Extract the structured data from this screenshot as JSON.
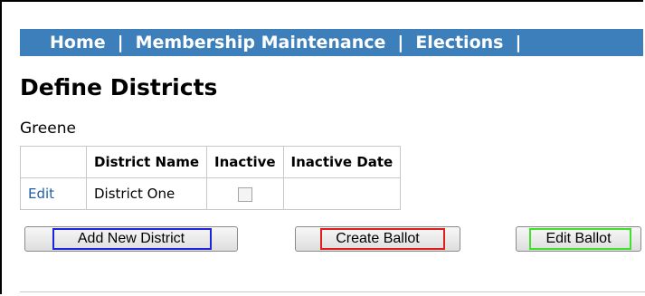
{
  "nav": {
    "items": [
      "Home",
      "Membership Maintenance",
      "Elections"
    ],
    "separator": "|"
  },
  "page": {
    "title": "Define Districts",
    "org_name": "Greene"
  },
  "table": {
    "headers": [
      "",
      "District Name",
      "Inactive",
      "Inactive Date"
    ],
    "rows": [
      {
        "action": "Edit",
        "district_name": "District One",
        "inactive": false,
        "inactive_date": ""
      }
    ]
  },
  "buttons": {
    "add_new_district": "Add New District",
    "create_ballot": "Create Ballot",
    "edit_ballot": "Edit Ballot"
  },
  "colors": {
    "nav_bg": "#3d7fba",
    "link": "#1f5fa6",
    "highlight_add": "#1d24e0",
    "highlight_create": "#e01d1d",
    "highlight_edit": "#3de02a"
  }
}
